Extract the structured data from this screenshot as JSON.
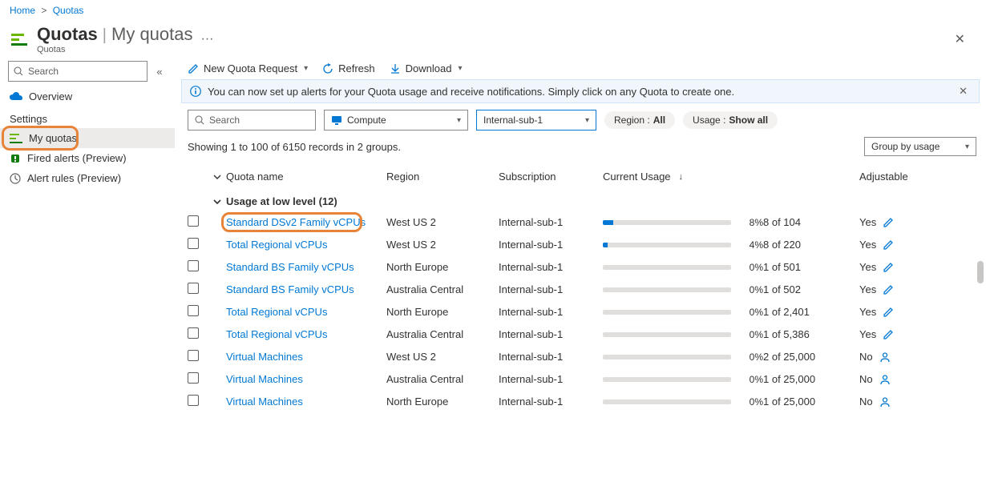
{
  "breadcrumb": {
    "home": "Home",
    "current": "Quotas"
  },
  "header": {
    "title": "Quotas",
    "subtitle_sep": "|",
    "subtitle": "My quotas",
    "caption": "Quotas",
    "dots": "···"
  },
  "sidebar": {
    "search_placeholder": "Search",
    "overview": "Overview",
    "section_settings": "Settings",
    "my_quotas": "My quotas",
    "fired_alerts": "Fired alerts (Preview)",
    "alert_rules": "Alert rules (Preview)"
  },
  "toolbar": {
    "new_request": "New Quota Request",
    "refresh": "Refresh",
    "download": "Download"
  },
  "info_bar": "You can now set up alerts for your Quota usage and receive notifications. Simply click on any Quota to create one.",
  "filters": {
    "search_placeholder": "Search",
    "provider": "Compute",
    "subscription": "Internal-sub-1",
    "region_label": "Region :",
    "region_value": "All",
    "usage_label": "Usage :",
    "usage_value": "Show all"
  },
  "records_line": "Showing 1 to 100 of 6150 records in 2 groups.",
  "groupby": "Group by usage",
  "columns": {
    "name": "Quota name",
    "region": "Region",
    "subscription": "Subscription",
    "usage": "Current Usage",
    "adjustable": "Adjustable"
  },
  "group": {
    "label": "Usage at low level (12)"
  },
  "rows": [
    {
      "name": "Standard DSv2 Family vCPUs",
      "region": "West US 2",
      "sub": "Internal-sub-1",
      "pct": 8,
      "qty": "8 of 104",
      "adj": "Yes",
      "highlight": true,
      "adj_icon": "edit"
    },
    {
      "name": "Total Regional vCPUs",
      "region": "West US 2",
      "sub": "Internal-sub-1",
      "pct": 4,
      "qty": "8 of 220",
      "adj": "Yes",
      "adj_icon": "edit"
    },
    {
      "name": "Standard BS Family vCPUs",
      "region": "North Europe",
      "sub": "Internal-sub-1",
      "pct": 0,
      "qty": "1 of 501",
      "adj": "Yes",
      "adj_icon": "edit"
    },
    {
      "name": "Standard BS Family vCPUs",
      "region": "Australia Central",
      "sub": "Internal-sub-1",
      "pct": 0,
      "qty": "1 of 502",
      "adj": "Yes",
      "adj_icon": "edit"
    },
    {
      "name": "Total Regional vCPUs",
      "region": "North Europe",
      "sub": "Internal-sub-1",
      "pct": 0,
      "qty": "1 of 2,401",
      "adj": "Yes",
      "adj_icon": "edit"
    },
    {
      "name": "Total Regional vCPUs",
      "region": "Australia Central",
      "sub": "Internal-sub-1",
      "pct": 0,
      "qty": "1 of 5,386",
      "adj": "Yes",
      "adj_icon": "edit"
    },
    {
      "name": "Virtual Machines",
      "region": "West US 2",
      "sub": "Internal-sub-1",
      "pct": 0,
      "qty": "2 of 25,000",
      "adj": "No",
      "adj_icon": "person"
    },
    {
      "name": "Virtual Machines",
      "region": "Australia Central",
      "sub": "Internal-sub-1",
      "pct": 0,
      "qty": "1 of 25,000",
      "adj": "No",
      "adj_icon": "person"
    },
    {
      "name": "Virtual Machines",
      "region": "North Europe",
      "sub": "Internal-sub-1",
      "pct": 0,
      "qty": "1 of 25,000",
      "adj": "No",
      "adj_icon": "person"
    }
  ]
}
